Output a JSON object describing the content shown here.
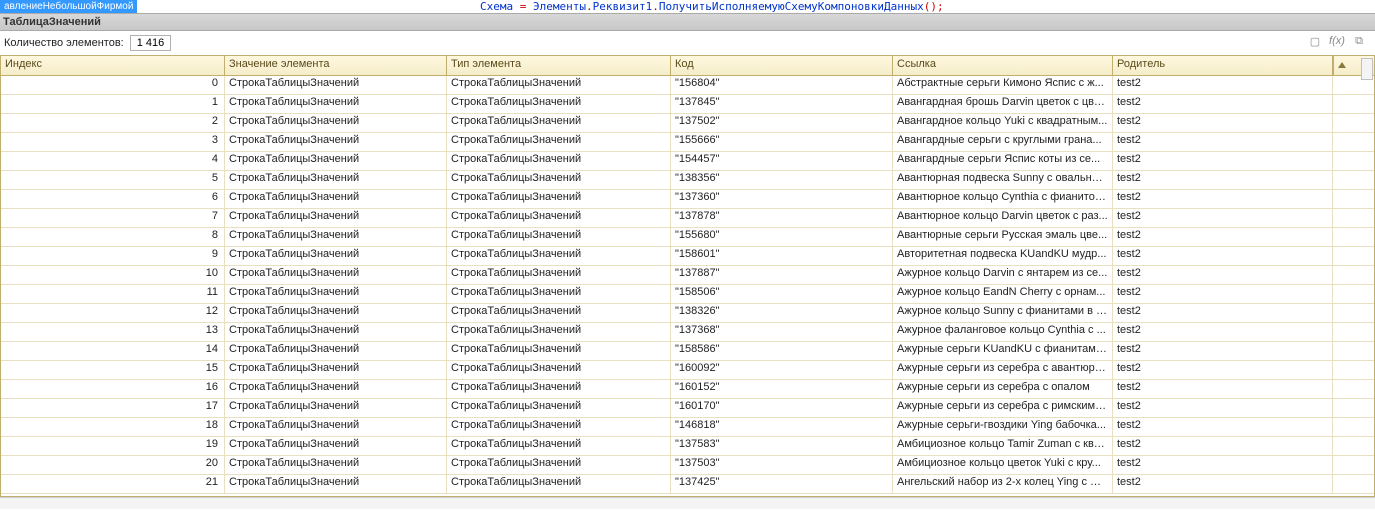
{
  "top_highlight": "авлениеНебольшойФирмой",
  "code": {
    "w1": "Схема",
    "op": "=",
    "w2": "Элементы",
    "dot1": ".",
    "w3": "Реквизит1",
    "dot2": ".",
    "w4": "ПолучитьИсполняемуюСхемуКомпоновкиДанных",
    "tail": "();"
  },
  "title": "ТаблицаЗначений",
  "count_label": "Количество элементов:",
  "count_value": "1 416",
  "columns": {
    "idx": "Индекс",
    "val": "Значение элемента",
    "type": "Тип элемента",
    "code": "Код",
    "link": "Ссылка",
    "parent": "Родитель"
  },
  "cell_defaults": {
    "val": "СтрокаТаблицыЗначений",
    "type": "СтрокаТаблицыЗначений",
    "parent": "test2"
  },
  "rows": [
    {
      "idx": 0,
      "code": "\"156804\"",
      "link": "Абстрактные серьги Кимоно Яспис с ж..."
    },
    {
      "idx": 1,
      "code": "\"137845\"",
      "link": "Авангардная брошь Darvin цветок с цве..."
    },
    {
      "idx": 2,
      "code": "\"137502\"",
      "link": "Авангардное кольцо Yuki с квадратным..."
    },
    {
      "idx": 3,
      "code": "\"155666\"",
      "link": "Авангардные серьги с круглыми грана..."
    },
    {
      "idx": 4,
      "code": "\"154457\"",
      "link": "Авангардные серьги Яспис коты из се..."
    },
    {
      "idx": 5,
      "code": "\"138356\"",
      "link": "Авантюрная подвеска Sunny с овальны..."
    },
    {
      "idx": 6,
      "code": "\"137360\"",
      "link": "Авантюрное кольцо Cynthia с фианитов..."
    },
    {
      "idx": 7,
      "code": "\"137878\"",
      "link": "Авантюрное кольцо Darvin цветок с раз..."
    },
    {
      "idx": 8,
      "code": "\"155680\"",
      "link": "Авантюрные серьги Русская эмаль цве..."
    },
    {
      "idx": 9,
      "code": "\"158601\"",
      "link": "Авторитетная подвеска KUandKU мудр..."
    },
    {
      "idx": 10,
      "code": "\"137887\"",
      "link": "Ажурное кольцо Darvin с янтарем из се..."
    },
    {
      "idx": 11,
      "code": "\"158506\"",
      "link": "Ажурное кольцо EandN Cherry с орнам..."
    },
    {
      "idx": 12,
      "code": "\"138326\"",
      "link": "Ажурное кольцо Sunny с фианитами в у..."
    },
    {
      "idx": 13,
      "code": "\"137368\"",
      "link": "Ажурное фаланговое кольцо Cynthia с ..."
    },
    {
      "idx": 14,
      "code": "\"158586\"",
      "link": "Ажурные серьги KUandKU с фианитами..."
    },
    {
      "idx": 15,
      "code": "\"160092\"",
      "link": "Ажурные серьги из серебра с авантюри..."
    },
    {
      "idx": 16,
      "code": "\"160152\"",
      "link": "Ажурные серьги из серебра с опалом"
    },
    {
      "idx": 17,
      "code": "\"160170\"",
      "link": "Ажурные серьги из серебра с римскими..."
    },
    {
      "idx": 18,
      "code": "\"146818\"",
      "link": "Ажурные серьги-гвоздики Ying бабочка..."
    },
    {
      "idx": 19,
      "code": "\"137583\"",
      "link": "Амбициозное кольцо Tamir Zuman с ква..."
    },
    {
      "idx": 20,
      "code": "\"137503\"",
      "link": "Амбициозное кольцо цветок Yuki с кру..."
    },
    {
      "idx": 21,
      "code": "\"137425\"",
      "link": "Ангельский набор из 2-х колец Ying с ф..."
    }
  ]
}
